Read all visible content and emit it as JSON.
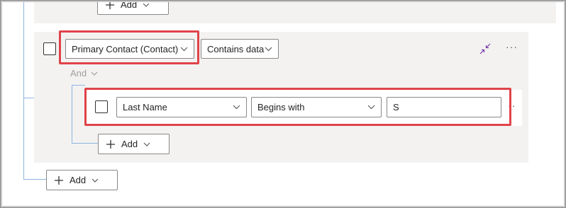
{
  "top_add": {
    "label": "Add"
  },
  "group": {
    "condition": {
      "field": "Primary Contact (Contact)",
      "operator": "Contains data"
    },
    "and_label": "And",
    "nested": {
      "field": "Last Name",
      "operator": "Begins with",
      "value": "S"
    },
    "add_label": "Add"
  },
  "bottom_add": {
    "label": "Add"
  },
  "colors": {
    "highlight": "#e0434a",
    "tree_line": "#8fb3e0",
    "group_bg": "#f3f2f1"
  }
}
